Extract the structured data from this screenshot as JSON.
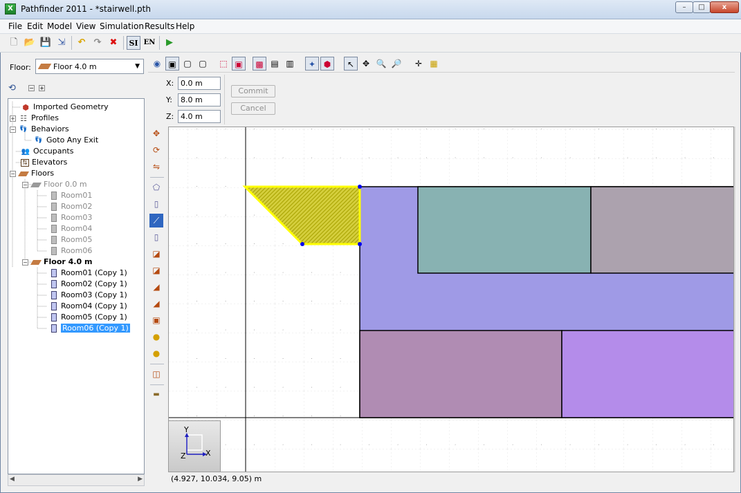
{
  "window": {
    "title": "Pathfinder 2011 - *stairwell.pth",
    "app_icon_glyph": "X"
  },
  "window_controls": {
    "minimize": "–",
    "maximize": "□",
    "close": "x"
  },
  "menu": [
    "File",
    "Edit",
    "Model",
    "View",
    "Simulation",
    "Results",
    "Help"
  ],
  "toolbar": {
    "items": [
      {
        "name": "new-file-icon",
        "glyph": "🗋"
      },
      {
        "name": "open-folder-icon",
        "glyph": "📂"
      },
      {
        "name": "save-icon",
        "glyph": "💾"
      },
      {
        "name": "import-icon",
        "glyph": "⇲"
      },
      {
        "name": "undo-icon",
        "glyph": "↶"
      },
      {
        "name": "redo-icon",
        "glyph": "↷"
      },
      {
        "name": "delete-icon",
        "glyph": "✖"
      },
      {
        "name": "si-units-button",
        "label": "SI"
      },
      {
        "name": "en-units-button",
        "label": "EN"
      },
      {
        "name": "run-simulation-icon",
        "glyph": "▶"
      }
    ]
  },
  "floor_selector": {
    "label": "Floor:",
    "value": "Floor 4.0 m"
  },
  "tree": {
    "items": [
      {
        "label": "Imported Geometry",
        "icon": "imported-geometry-icon",
        "glyph": "⬢"
      },
      {
        "label": "Profiles",
        "icon": "profiles-icon",
        "glyph": "☷"
      },
      {
        "label": "Behaviors",
        "icon": "behaviors-icon",
        "glyph": "👣"
      },
      {
        "label": "Goto Any Exit",
        "icon": "footsteps-icon",
        "glyph": "👣"
      },
      {
        "label": "Occupants",
        "icon": "occupants-icon",
        "glyph": "👥"
      },
      {
        "label": "Elevators",
        "icon": "elevator-icon",
        "glyph": "⇅"
      },
      {
        "label": "Floors",
        "icon": "floors-icon",
        "glyph": ""
      },
      {
        "label": "Floor 0.0 m",
        "icon": "floor-icon",
        "glyph": ""
      },
      {
        "label": "Room01"
      },
      {
        "label": "Room02"
      },
      {
        "label": "Room03"
      },
      {
        "label": "Room04"
      },
      {
        "label": "Room05"
      },
      {
        "label": "Room06"
      },
      {
        "label": "Floor 4.0 m",
        "icon": "floor-icon",
        "glyph": ""
      },
      {
        "label": "Room01 (Copy 1)"
      },
      {
        "label": "Room02 (Copy 1)"
      },
      {
        "label": "Room03 (Copy 1)"
      },
      {
        "label": "Room04 (Copy 1)"
      },
      {
        "label": "Room05 (Copy 1)"
      },
      {
        "label": "Room06 (Copy 1)"
      }
    ]
  },
  "coords": {
    "x_label": "X:",
    "x": "0.0 m",
    "y_label": "Y:",
    "y": "8.0 m",
    "z_label": "Z:",
    "z": "4.0 m"
  },
  "buttons": {
    "commit": "Commit",
    "cancel": "Cancel"
  },
  "axis_gizmo": {
    "y": "Y",
    "x": "X",
    "z": "Z"
  },
  "status": {
    "cursor": "(4.927, 10.034, 9.05) m"
  },
  "colors": {
    "room_blue": "#9f9ae6",
    "room_teal": "#88b2b2",
    "room_gray": "#aca2ae",
    "room_mauve": "#b08cb3",
    "room_purple": "#b48cea",
    "selection": "#ffff00",
    "selection_hatch": "#c8c200",
    "vertex": "#0000ee"
  }
}
